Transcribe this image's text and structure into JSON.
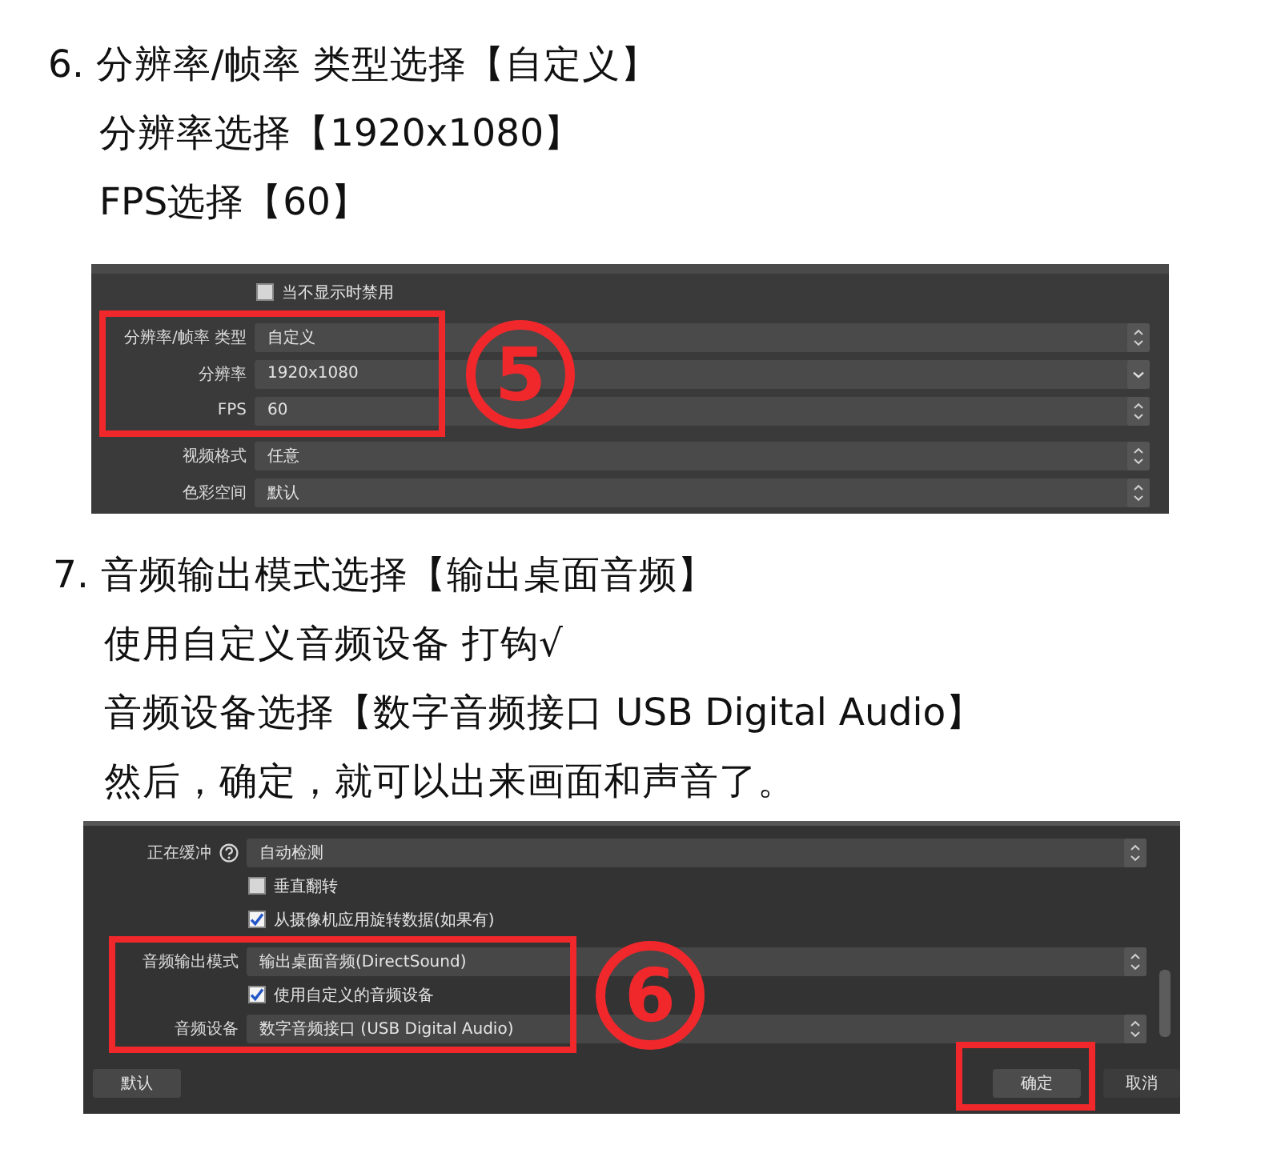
{
  "steps": [
    {
      "heading": "6. 分辨率/帧率 类型选择【自定义】",
      "lines": [
        "分辨率选择【1920x1080】",
        "FPS选择【60】"
      ],
      "panel": {
        "groups": [
          {
            "rows": [
              {
                "kind": "checkbox",
                "label": "当不显示时禁用",
                "checked": false
              }
            ]
          },
          {
            "highlighted": true,
            "marker": "5",
            "rows": [
              {
                "kind": "select",
                "label": "分辨率/帧率 类型",
                "value": "自定义"
              },
              {
                "kind": "editable",
                "label": "分辨率",
                "value": "1920x1080"
              },
              {
                "kind": "select",
                "label": "FPS",
                "value": "60"
              }
            ]
          },
          {
            "rows": [
              {
                "kind": "select",
                "label": "视频格式",
                "value": "任意"
              },
              {
                "kind": "select",
                "label": "色彩空间",
                "value": "默认"
              }
            ]
          }
        ]
      }
    },
    {
      "heading": "7. 音频输出模式选择【输出桌面音频】",
      "lines": [
        "使用自定义音频设备 打钩√",
        "音频设备选择【数字音频接口 USB Digital Audio】",
        "然后，确定，就可以出来画面和声音了。"
      ],
      "panel": {
        "scrollbar": true,
        "groups": [
          {
            "rows": [
              {
                "kind": "select",
                "label": "正在缓冲",
                "help": true,
                "value": "自动检测"
              },
              {
                "kind": "checkbox",
                "label": "垂直翻转",
                "checked": false
              },
              {
                "kind": "checkbox",
                "label": "从摄像机应用旋转数据(如果有)",
                "checked": true
              }
            ]
          },
          {
            "highlighted": true,
            "marker": "6",
            "rows": [
              {
                "kind": "select",
                "label": "音频输出模式",
                "value": "输出桌面音频(DirectSound)"
              },
              {
                "kind": "checkbox",
                "label": "使用自定义的音频设备",
                "checked": true
              },
              {
                "kind": "select",
                "label": "音频设备",
                "value": "数字音频接口 (USB Digital Audio)"
              }
            ]
          }
        ],
        "footer": {
          "left_buttons": [
            {
              "label": "默认"
            }
          ],
          "right_buttons": [
            {
              "label": "确定",
              "highlighted": true
            },
            {
              "label": "取消"
            }
          ]
        }
      }
    }
  ]
}
